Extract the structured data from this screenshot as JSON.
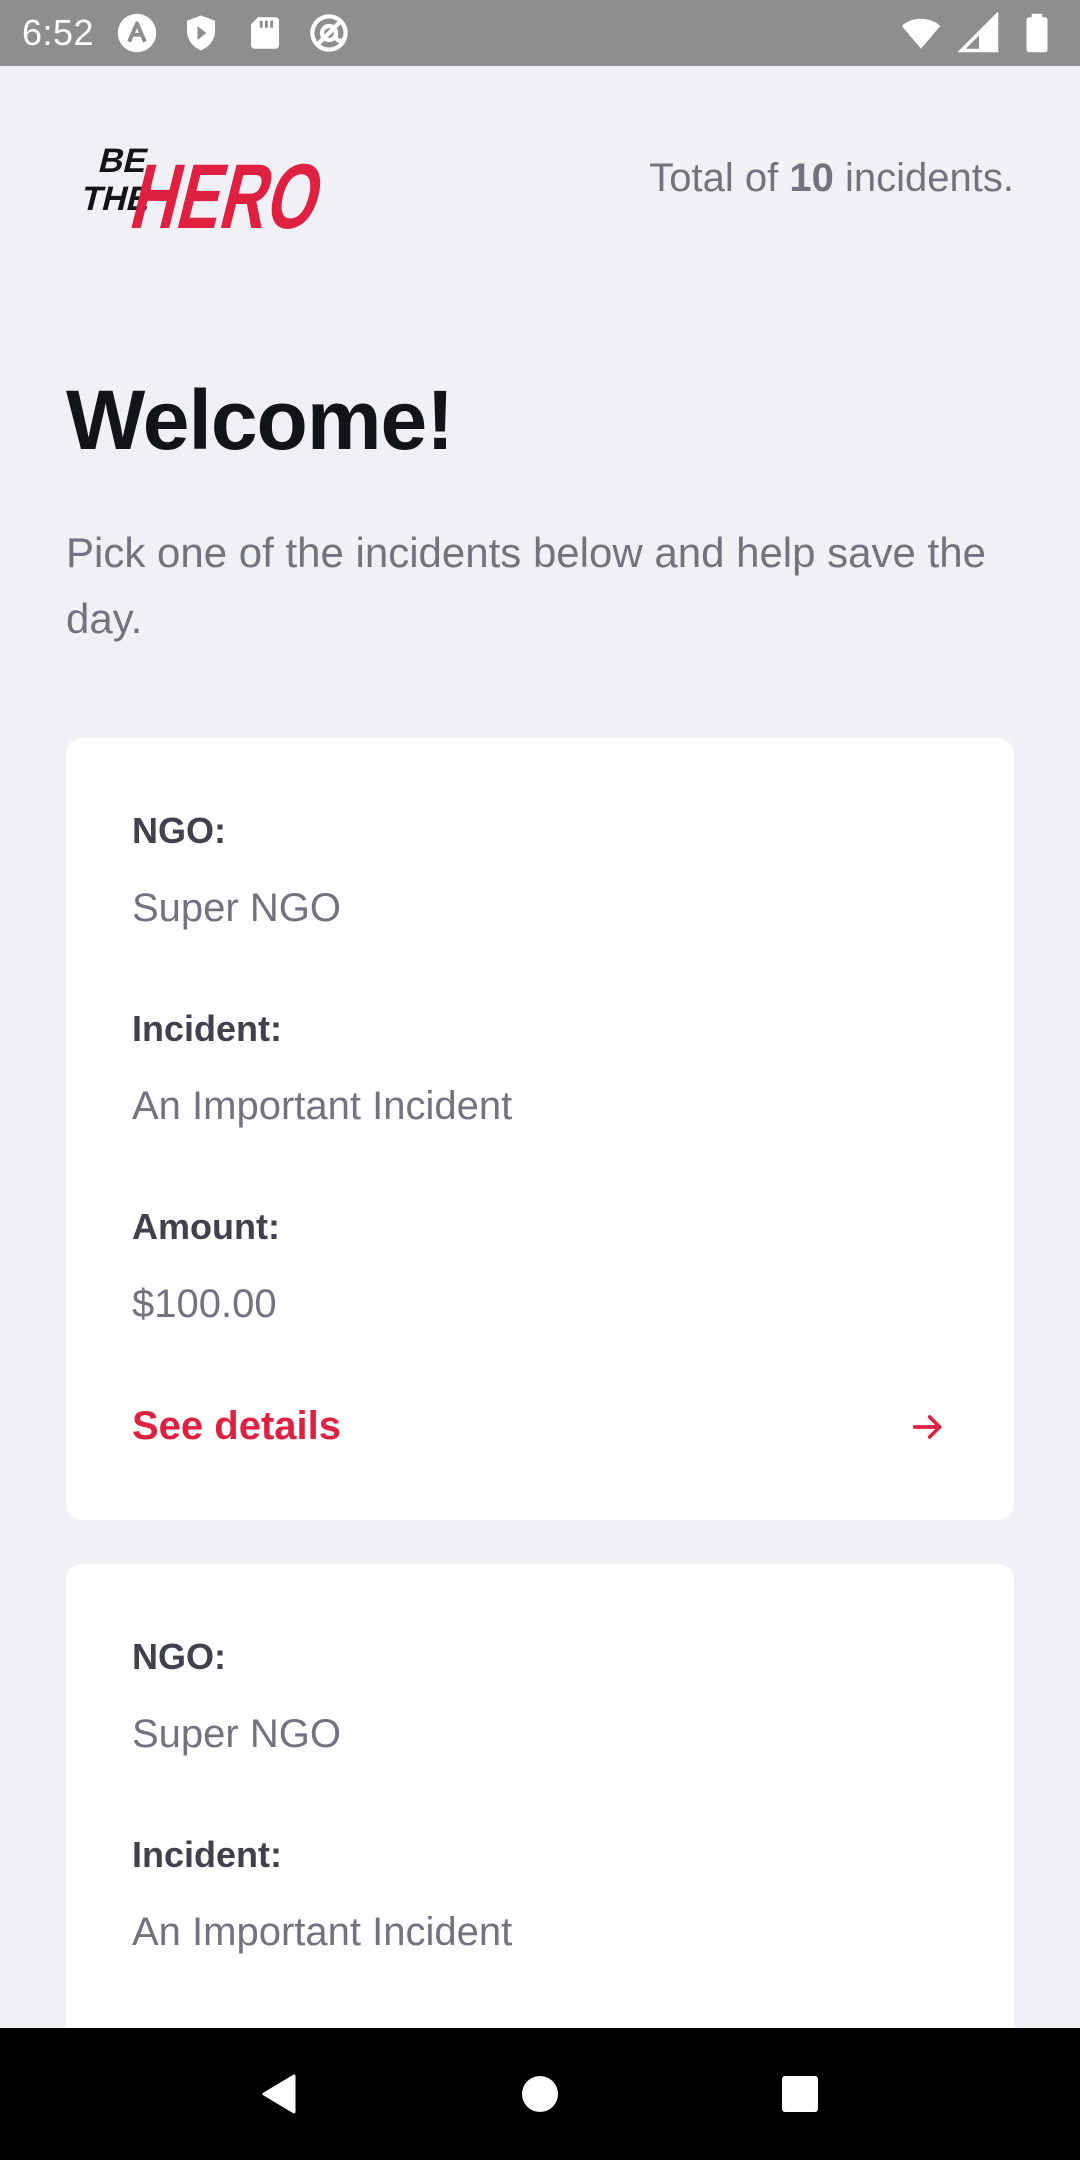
{
  "status_bar": {
    "time": "6:52",
    "icons_left": [
      "autofill-icon",
      "shield-icon",
      "sd-card-icon",
      "at-sign-icon"
    ],
    "icons_right": [
      "wifi-icon",
      "signal-icon",
      "battery-icon"
    ]
  },
  "header": {
    "logo_text_small": "BE THE",
    "logo_text_large": "HERO",
    "total_prefix": "Total of",
    "total_count": "10",
    "total_suffix": "incidents."
  },
  "main": {
    "title": "Welcome!",
    "subtitle": "Pick one of the incidents below and help save the day."
  },
  "incidents": [
    {
      "ngo_label": "NGO:",
      "ngo_value": "Super NGO",
      "incident_label": "Incident:",
      "incident_value": "An Important Incident",
      "amount_label": "Amount:",
      "amount_value": "$100.00",
      "details_label": "See details"
    },
    {
      "ngo_label": "NGO:",
      "ngo_value": "Super NGO",
      "incident_label": "Incident:",
      "incident_value": "An Important Incident"
    }
  ],
  "colors": {
    "brand_red": "#e02041",
    "background": "#f0f0f5",
    "text_dark": "#13131a",
    "text_muted": "#737380",
    "label_dark": "#41414d"
  },
  "nav_bar": {
    "icons": [
      "back-icon",
      "home-icon",
      "recents-icon"
    ]
  }
}
